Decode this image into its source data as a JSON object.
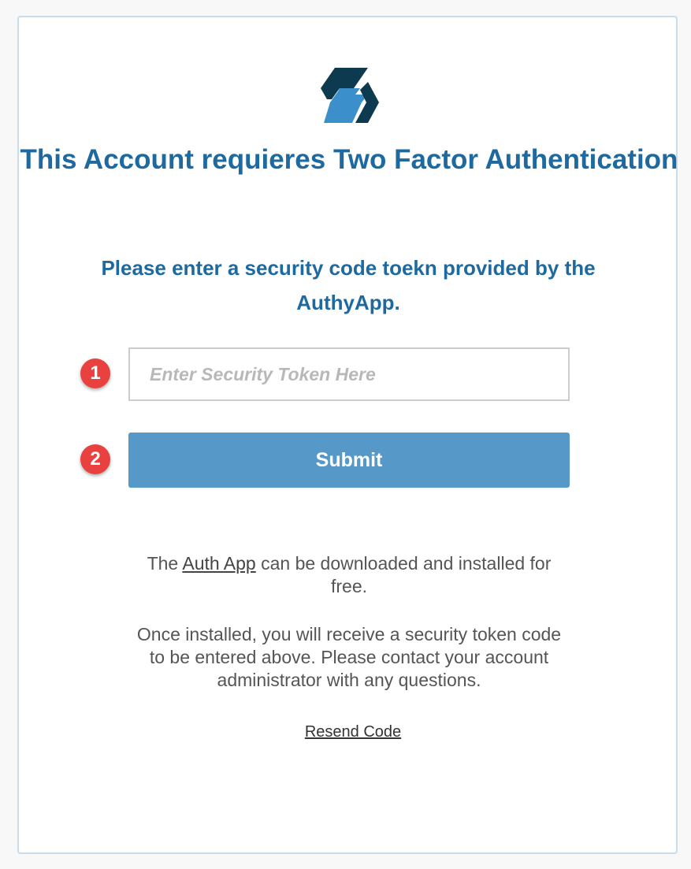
{
  "logo": {
    "icon": "authy-logo-icon",
    "colors": {
      "dark": "#0d3a4f",
      "light": "#3b8fca"
    }
  },
  "title": "This Account requieres Two Factor Authentication",
  "subtitle": "Please enter a security code toekn provided by the AuthyApp.",
  "badges": {
    "first": "1",
    "second": "2"
  },
  "token_input": {
    "placeholder": "Enter Security Token Here",
    "value": ""
  },
  "submit_label": "Submit",
  "info": {
    "line1_before": "The ",
    "line1_link": "Auth App",
    "line1_after": " can be downloaded and installed for free.",
    "paragraph2": "Once installed, you will receive a security token code to be entered above. Please contact your account administrator with any questions."
  },
  "resend_label": "Resend Code",
  "colors": {
    "accent": "#1e6aa0",
    "button": "#5698c8",
    "badge": "#e8413f",
    "card_border": "#c9dcec"
  }
}
